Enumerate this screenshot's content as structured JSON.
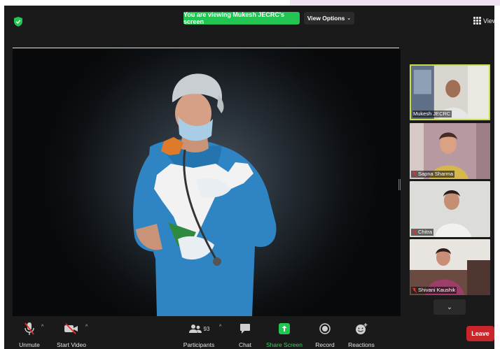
{
  "header": {
    "banner_text": "You are viewing Mukesh JECRC's screen",
    "view_options_label": "View Options",
    "view_label": "View"
  },
  "shared_content": {
    "description_icon": "nurse-with-india-map-illustration"
  },
  "participants_panel": [
    {
      "name": "Mukesh JECRC",
      "muted": false,
      "active_speaker": true
    },
    {
      "name": "Sapna Sharma",
      "muted": true,
      "active_speaker": false
    },
    {
      "name": "Chitra",
      "muted": true,
      "active_speaker": false
    },
    {
      "name": "Shivani Kaushik",
      "muted": true,
      "active_speaker": false
    }
  ],
  "toolbar": {
    "unmute_label": "Unmute",
    "start_video_label": "Start Video",
    "participants_label": "Participants",
    "participants_count": "93",
    "chat_label": "Chat",
    "share_screen_label": "Share Screen",
    "record_label": "Record",
    "reactions_label": "Reactions",
    "leave_label": "Leave"
  },
  "colors": {
    "banner_green": "#23c552",
    "active_border": "#c8dc4a",
    "leave_red": "#c8262b",
    "share_green": "#37d15e"
  }
}
